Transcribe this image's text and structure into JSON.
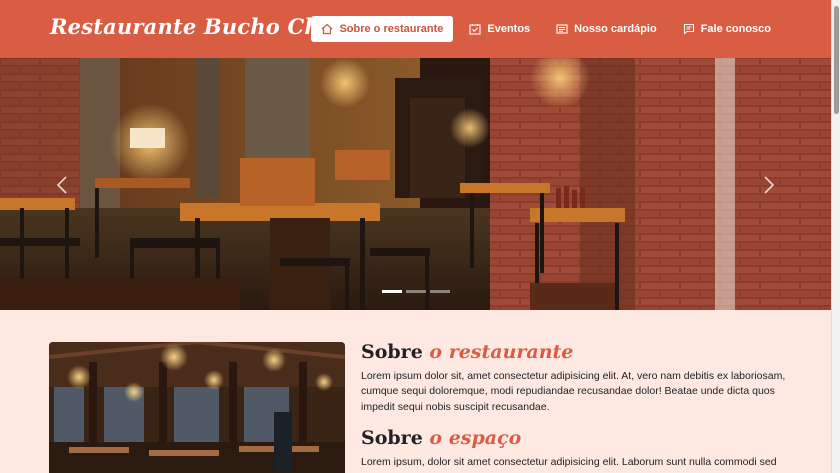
{
  "header": {
    "brand": "Restaurante Bucho Cheio",
    "nav": [
      {
        "label": "Sobre o restaurante",
        "icon": "home-icon",
        "active": true
      },
      {
        "label": "Eventos",
        "icon": "calendar-check-icon",
        "active": false
      },
      {
        "label": "Nosso cardápio",
        "icon": "menu-list-icon",
        "active": false
      },
      {
        "label": "Fale conosco",
        "icon": "chat-icon",
        "active": false
      }
    ]
  },
  "carousel": {
    "slide_count": 3,
    "active_slide": 1
  },
  "about": {
    "title_main": "Sobre",
    "title_accent": "o restaurante",
    "text": "Lorem ipsum dolor sit, amet consectetur adipisicing elit. At, vero nam debitis ex laboriosam, cumque sequi doloremque, modi repudiandae recusandae dolor! Beatae unde dicta quos impedit sequi nobis suscipit recusandae."
  },
  "space": {
    "title_main": "Sobre",
    "title_accent": "o espaço",
    "text": "Lorem ipsum, dolor sit amet consectetur adipisicing elit. Laborum sunt nulla commodi sed"
  },
  "colors": {
    "brand": "#d95d43",
    "background": "#fde8e2"
  }
}
